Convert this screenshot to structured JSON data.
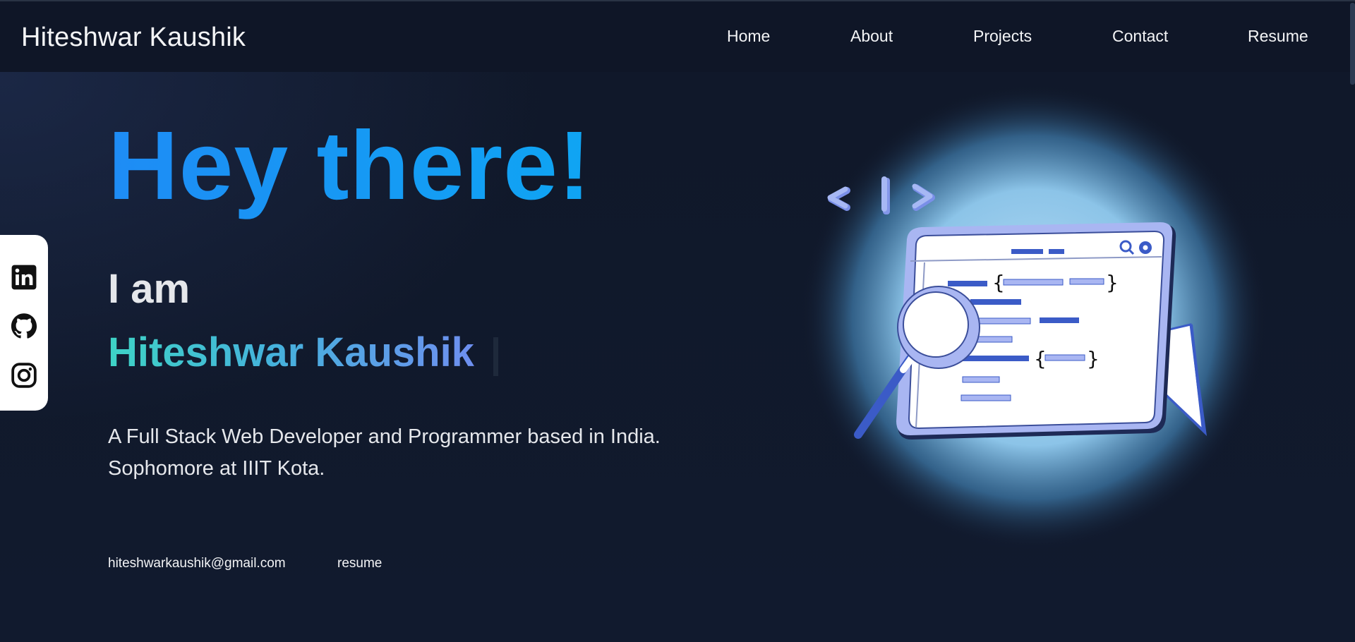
{
  "header": {
    "brand": "Hiteshwar Kaushik",
    "nav": [
      "Home",
      "About",
      "Projects",
      "Contact",
      "Resume"
    ]
  },
  "social": {
    "icons": [
      "linkedin-icon",
      "github-icon",
      "instagram-icon"
    ]
  },
  "hero": {
    "greeting": "Hey there!",
    "intro": "I am",
    "name": "Hiteshwar Kaushik",
    "description_line1": "A Full Stack Web Developer and Programmer based in India.",
    "description_line2": "Sophomore at IIIT Kota.",
    "email": "hiteshwarkaushik@gmail.com",
    "resume_link": "resume"
  },
  "colors": {
    "background": "#111827",
    "navbar": "#0f1627",
    "greeting_gradient": [
      "#1e8cf5",
      "#0fa5f3"
    ],
    "name_gradient": [
      "#3ed3c6",
      "#6e8ff0"
    ],
    "illustration_accent": "#3b5bc7"
  }
}
